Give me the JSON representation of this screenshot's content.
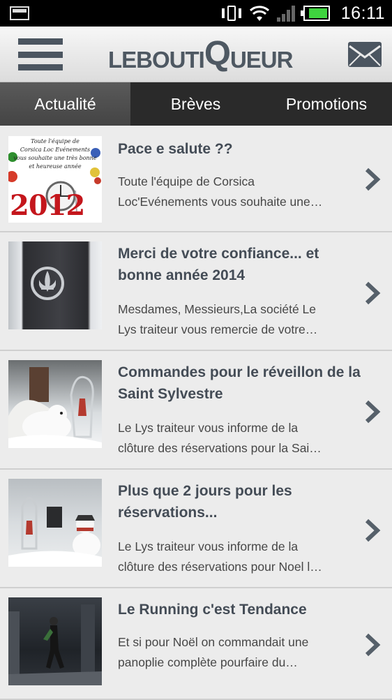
{
  "status_bar": {
    "time": "16:11",
    "battery_level": 0.85
  },
  "app_bar": {
    "logo_small_1": "LEBOUTI",
    "logo_big": "Q",
    "logo_small_2": "UEUR"
  },
  "tabs": [
    {
      "label": "Actualité",
      "active": true
    },
    {
      "label": "Brèves",
      "active": false
    },
    {
      "label": "Promotions",
      "active": false
    }
  ],
  "news": [
    {
      "title_lines": [
        "Pace e salute ??"
      ],
      "desc_lines": [
        "Toute l'équipe de Corsica",
        "Loc'Evénements vous souhaite une…"
      ],
      "thumb_text": [
        "Toute l'équipe de",
        "Corsica Loc Evénements",
        "vous souhaite une très bonne",
        "et heureuse année"
      ],
      "thumb_year": "2012"
    },
    {
      "title_lines": [
        "Merci de votre confiance... et",
        "bonne année 2014"
      ],
      "desc_lines": [
        "Mesdames, Messieurs,La société Le",
        "Lys traiteur vous remercie de votre…"
      ]
    },
    {
      "title_lines": [
        "Commandes pour le réveillon de la",
        "Saint Sylvestre"
      ],
      "desc_lines": [
        "Le Lys traiteur vous informe de la",
        "clôture des réservations pour la Sai…"
      ]
    },
    {
      "title_lines": [
        "Plus que 2 jours pour les",
        "réservations..."
      ],
      "desc_lines": [
        "Le Lys traiteur vous informe de la",
        "clôture des réservations pour Noel l…"
      ]
    },
    {
      "title_lines": [
        "Le Running c'est Tendance"
      ],
      "desc_lines": [
        "Et si pour Noël on commandait une",
        "panoplie complète pourfaire du…"
      ]
    }
  ]
}
